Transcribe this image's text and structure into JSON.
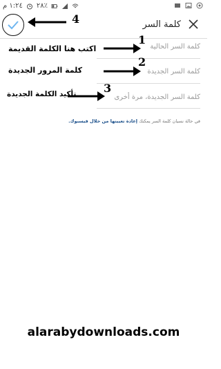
{
  "status_bar": {
    "time": "١:٢٤ م",
    "battery": "٢٨٪"
  },
  "header": {
    "title": "كلمة السر"
  },
  "fields": [
    {
      "placeholder": "كلمة السر الحالية"
    },
    {
      "placeholder": "كلمة السر الجديدة"
    },
    {
      "placeholder": "كلمة السر الجديدة، مرة أخرى"
    }
  ],
  "annotations": [
    {
      "number": "1",
      "text": "اكتب هنا الكلمة القديمة"
    },
    {
      "number": "2",
      "text": "كلمة المرور الجديدة"
    },
    {
      "number": "3",
      "text": "تأكيد الكلمة الجديدة"
    },
    {
      "number": "4",
      "text": ""
    }
  ],
  "forgot": {
    "prefix": "في حالة نسيان كلمة السر يمكنك",
    "link": "إعادة تعيينها من خلال فيسبوك."
  },
  "watermark": "alarabydownloads.com",
  "colors": {
    "accent": "#6fb6f0",
    "link": "#1a4f8a",
    "divider": "#dbdbdb"
  }
}
